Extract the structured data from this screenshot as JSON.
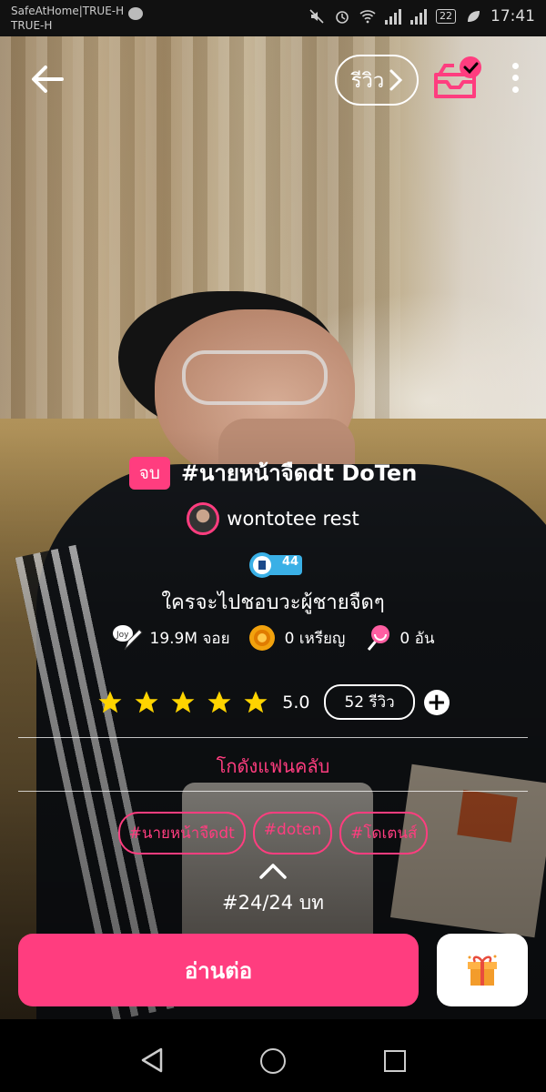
{
  "status_bar": {
    "carrier_line1": "SafeAtHome|TRUE-H",
    "carrier_line2": "TRUE-H",
    "battery": "22",
    "time": "17:41"
  },
  "top_bar": {
    "review_label": "รีวิว"
  },
  "story": {
    "status_badge": "จบ",
    "title": "#นายหน้าจืดdt DoTen",
    "author": "wontotee rest",
    "level": "44",
    "tagline": "ใครจะไปชอบวะผู้ชายจืดๆ",
    "reads": "19.9M จอย",
    "coins": "0 เหรียญ",
    "candies": "0 อัน",
    "rating": {
      "stars": 5,
      "score": "5.0",
      "reviews": "52 รีวิว"
    },
    "fan_link": "โกดังแฟนคลับ",
    "tags": [
      "#นายหน้าจืดdt",
      "#doten",
      "#โดเตนส์"
    ],
    "episode": "#24/24 บท"
  },
  "actions": {
    "read_button": "อ่านต่อ"
  },
  "colors": {
    "accent": "#ff3d7f",
    "star": "#ffd400"
  },
  "icons": [
    "back-arrow-icon",
    "chevron-right-icon",
    "bookshelf-check-icon",
    "more-vertical-icon",
    "joy-pen-icon",
    "coin-icon",
    "candy-icon",
    "star-icon",
    "plus-icon",
    "chevron-up-icon",
    "gift-icon"
  ]
}
